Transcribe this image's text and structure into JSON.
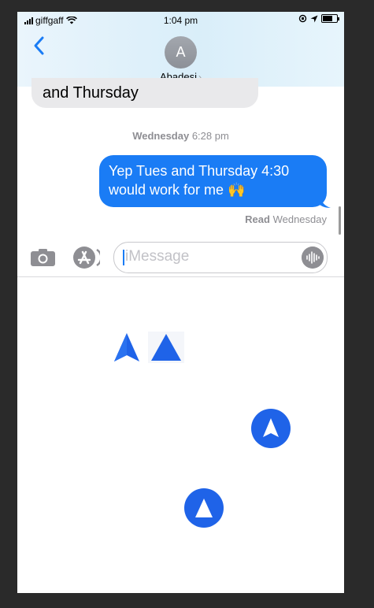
{
  "status_bar": {
    "carrier": "giffgaff",
    "time": "1:04 pm"
  },
  "header": {
    "avatar_initial": "A",
    "contact_name": "Abadesi",
    "contact_chevron": "›",
    "back_icon": "chevron-left-icon"
  },
  "messages": {
    "incoming_partial": "and Thursday",
    "date_day": "Wednesday",
    "date_time": "6:28 pm",
    "outgoing_text": "Yep Tues and Thursday 4:30 would work for me 🙌",
    "read_label": "Read",
    "read_when": "Wednesday"
  },
  "input_bar": {
    "placeholder": "iMessage",
    "camera_icon": "camera-icon",
    "apps_icon": "app-store-icon",
    "audio_icon": "audio-waveform-icon"
  },
  "colors": {
    "accent_blue": "#1a7cf5",
    "logo_blue": "#1f63e8",
    "incoming_bubble": "#e9e9eb"
  },
  "drawer_icons": [
    "a-logo-icon",
    "a-logo-icon",
    "a-logo-circle-icon",
    "a-logo-circle-icon"
  ]
}
